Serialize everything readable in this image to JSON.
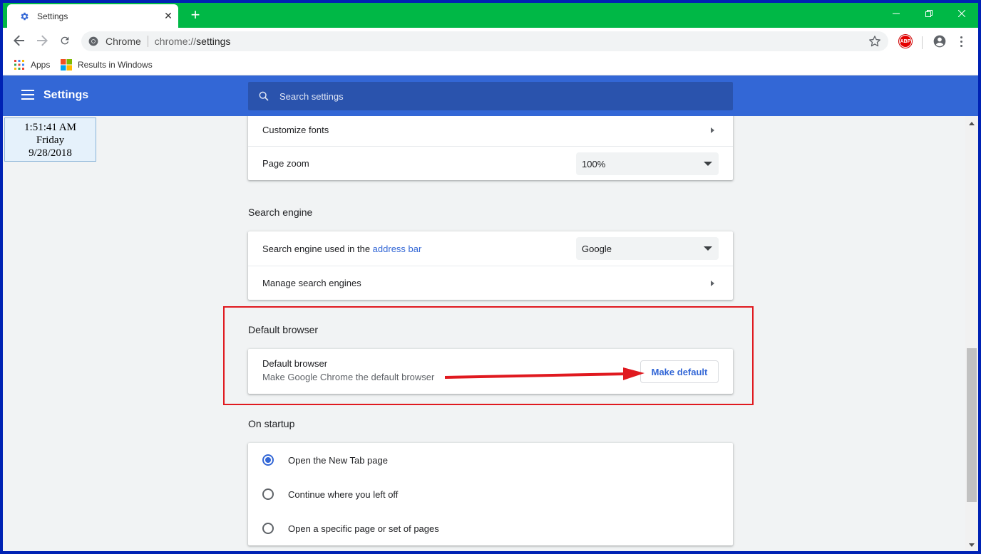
{
  "tab": {
    "title": "Settings",
    "close": "✕",
    "new_tab": "+"
  },
  "window_controls": {
    "minimize": "—",
    "restore": "❐",
    "close": "✕"
  },
  "omnibox": {
    "site": "Chrome",
    "url_prefix": "chrome://",
    "url_path": "settings"
  },
  "extensions": {
    "abp": "ABP"
  },
  "bookmarks": [
    {
      "label": "Apps",
      "icon": "apps-grid-icon"
    },
    {
      "label": "Results in Windows",
      "icon": "windows-logo-icon"
    }
  ],
  "header": {
    "title": "Settings",
    "search_placeholder": "Search settings"
  },
  "clock": {
    "time": "1:51:41 AM",
    "day": "Friday",
    "date": "9/28/2018"
  },
  "appearance": {
    "customize_fonts": "Customize fonts",
    "page_zoom_label": "Page zoom",
    "page_zoom_value": "100%"
  },
  "search_engine": {
    "section_title": "Search engine",
    "used_in_prefix": "Search engine used in the ",
    "used_in_link": "address bar",
    "selected": "Google",
    "manage": "Manage search engines"
  },
  "default_browser": {
    "section_title": "Default browser",
    "label": "Default browser",
    "description": "Make Google Chrome the default browser",
    "button": "Make default",
    "highlight_color": "#e0191f"
  },
  "on_startup": {
    "section_title": "On startup",
    "options": [
      {
        "label": "Open the New Tab page",
        "selected": true
      },
      {
        "label": "Continue where you left off",
        "selected": false
      },
      {
        "label": "Open a specific page or set of pages",
        "selected": false
      }
    ]
  },
  "colors": {
    "accent": "#3367d6",
    "titlebar": "#00b846",
    "frame": "#0022b4"
  }
}
